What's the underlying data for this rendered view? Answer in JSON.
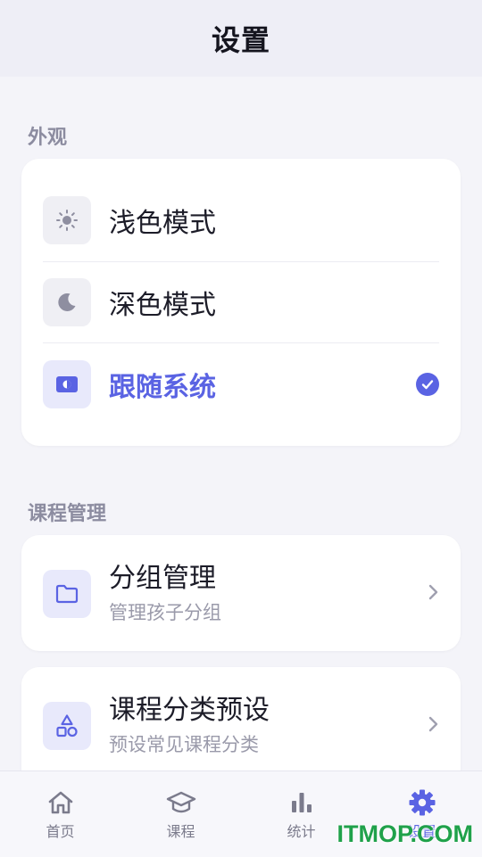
{
  "header": {
    "title": "设置"
  },
  "appearance": {
    "section_label": "外观",
    "options": [
      {
        "label": "浅色模式",
        "icon": "sun-icon",
        "selected": false
      },
      {
        "label": "深色模式",
        "icon": "moon-icon",
        "selected": false
      },
      {
        "label": "跟随系统",
        "icon": "auto-theme-icon",
        "selected": true
      }
    ]
  },
  "course_mgmt": {
    "section_label": "课程管理",
    "items": [
      {
        "title": "分组管理",
        "subtitle": "管理孩子分组",
        "icon": "folder-icon"
      },
      {
        "title": "课程分类预设",
        "subtitle": "预设常见课程分类",
        "icon": "shapes-icon"
      }
    ]
  },
  "tabbar": {
    "tabs": [
      {
        "label": "首页",
        "icon": "home-icon",
        "active": false
      },
      {
        "label": "课程",
        "icon": "graduation-cap-icon",
        "active": false
      },
      {
        "label": "统计",
        "icon": "bar-chart-icon",
        "active": false
      },
      {
        "label": "设置",
        "icon": "gear-icon",
        "active": true
      }
    ]
  },
  "watermark": "ITMOP.COM",
  "colors": {
    "accent": "#5a63e3",
    "background": "#f4f4f9",
    "card": "#ffffff",
    "muted_text": "#9a9aaa"
  }
}
